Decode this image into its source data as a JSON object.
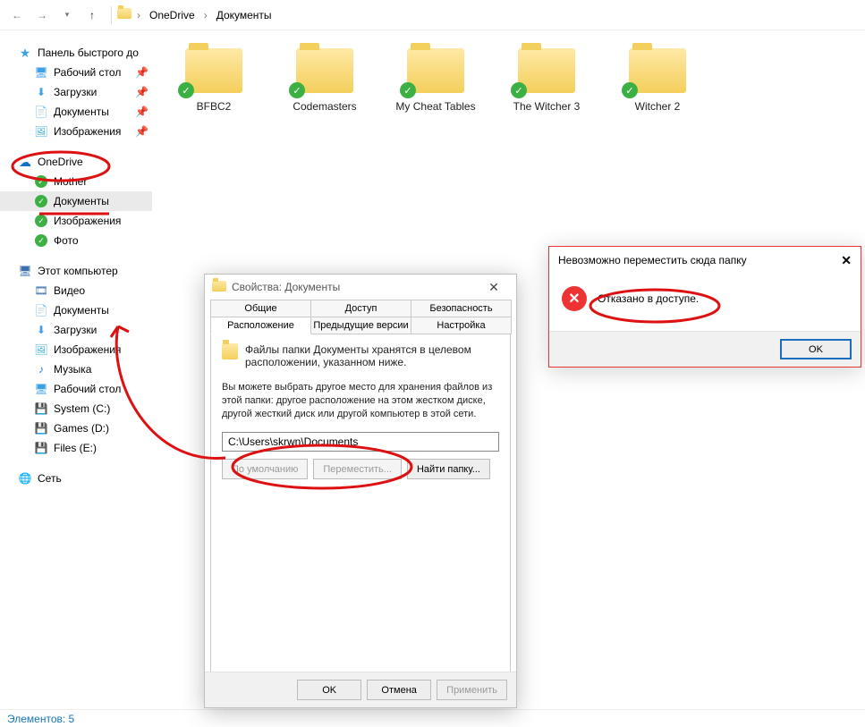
{
  "nav": {
    "chevron": "›",
    "breadcrumb": [
      "OneDrive",
      "Документы"
    ]
  },
  "sidebar": {
    "quick_header": "Панель быстрого до",
    "quick": [
      {
        "label": "Рабочий стол",
        "pin": true
      },
      {
        "label": "Загрузки",
        "pin": true
      },
      {
        "label": "Документы",
        "pin": true
      },
      {
        "label": "Изображения",
        "pin": true
      }
    ],
    "onedrive_header": "OneDrive",
    "onedrive": [
      {
        "label": "Mother"
      },
      {
        "label": "Документы"
      },
      {
        "label": "Изображения"
      },
      {
        "label": "Фото"
      }
    ],
    "thispc_header": "Этот компьютер",
    "thispc": [
      {
        "label": "Видео"
      },
      {
        "label": "Документы"
      },
      {
        "label": "Загрузки"
      },
      {
        "label": "Изображения"
      },
      {
        "label": "Музыка"
      },
      {
        "label": "Рабочий стол"
      },
      {
        "label": "System (C:)"
      },
      {
        "label": "Games (D:)"
      },
      {
        "label": "Files (E:)"
      }
    ],
    "network_header": "Сеть"
  },
  "folders": [
    "BFBC2",
    "Codemasters",
    "My Cheat Tables",
    "The Witcher 3",
    "Witcher 2"
  ],
  "properties": {
    "title": "Свойства: Документы",
    "tabs_row1": [
      "Общие",
      "Доступ",
      "Безопасность"
    ],
    "tabs_row2": [
      "Расположение",
      "Предыдущие версии",
      "Настройка"
    ],
    "line1": "Файлы папки Документы хранятся в целевом расположении, указанном ниже.",
    "para": "Вы можете выбрать другое место для хранения файлов из этой папки: другое расположение на этом жестком диске, другой жесткий диск или другой компьютер в этой сети.",
    "path": "C:\\Users\\skrwn\\Documents",
    "btn_default": "По умолчанию",
    "btn_move": "Переместить...",
    "btn_find": "Найти папку...",
    "ok": "OK",
    "cancel": "Отмена",
    "apply": "Применить"
  },
  "error": {
    "title": "Невозможно переместить сюда папку",
    "message": "Отказано в доступе.",
    "ok": "OK"
  },
  "status": {
    "text": "Элементов: 5"
  }
}
